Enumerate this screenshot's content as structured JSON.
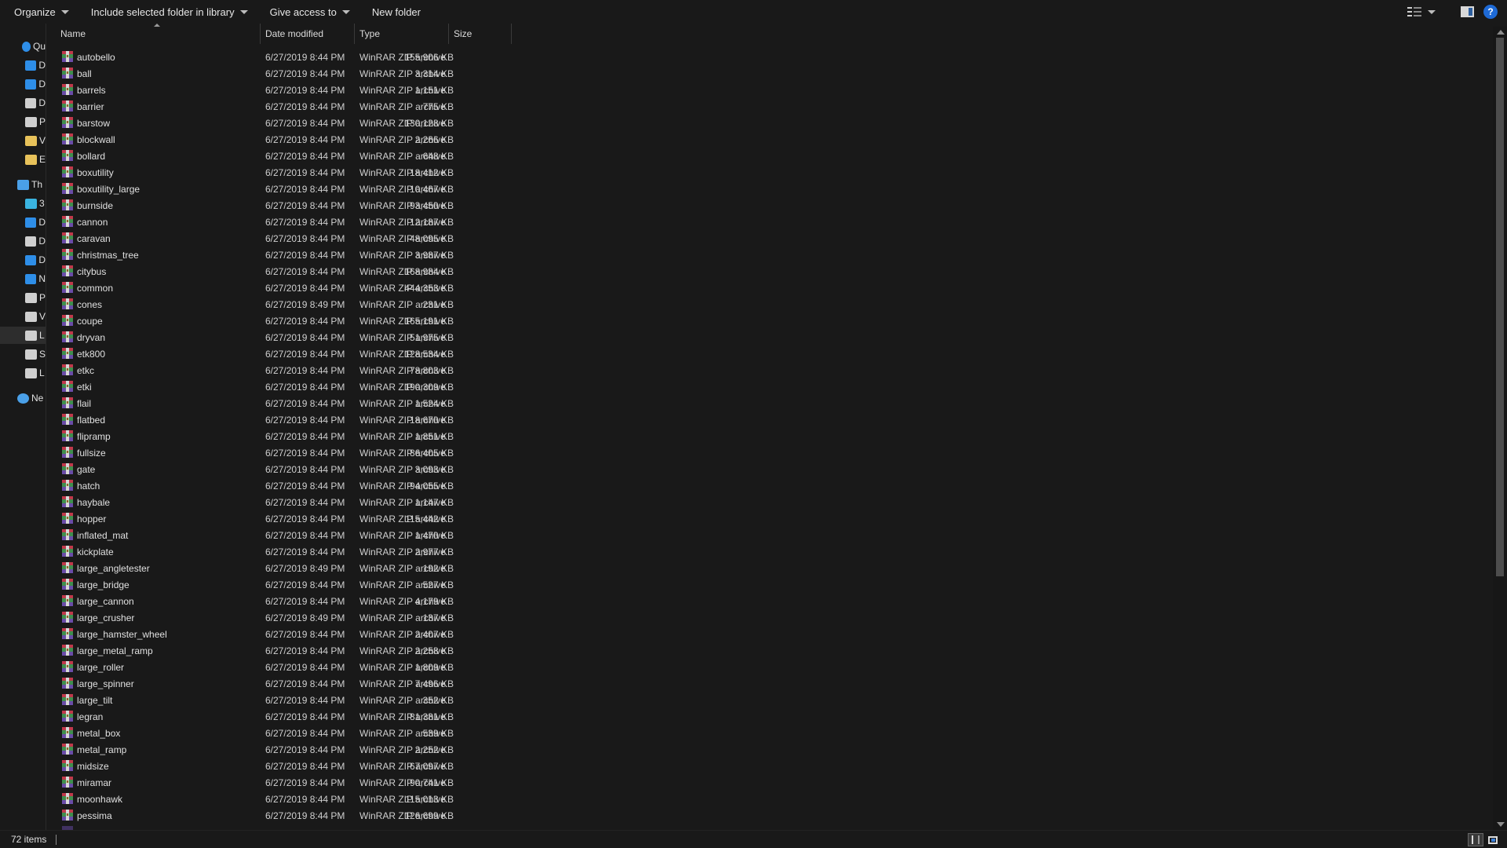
{
  "toolbar": {
    "organize": "Organize",
    "include_library": "Include selected folder in library",
    "give_access": "Give access to",
    "new_folder": "New folder"
  },
  "nav": {
    "items": [
      {
        "label": "Qu",
        "icon": "star-icon",
        "color": "#2e8ee8"
      },
      {
        "label": "D",
        "icon": "desktop-icon",
        "color": "#2e8ee8"
      },
      {
        "label": "D",
        "icon": "download-arrow-icon",
        "color": "#2e8ee8"
      },
      {
        "label": "D",
        "icon": "document-icon",
        "color": "#cfcfcf"
      },
      {
        "label": "P",
        "icon": "pictures-icon",
        "color": "#cfcfcf"
      },
      {
        "label": "V",
        "icon": "folder-icon",
        "color": "#e8c25a"
      },
      {
        "label": "E",
        "icon": "folder-icon",
        "color": "#e8c25a"
      },
      {
        "label": "Th",
        "icon": "computer-icon",
        "color": "#4aa0e8"
      },
      {
        "label": "3",
        "icon": "3d-objects-icon",
        "color": "#3ab4e0"
      },
      {
        "label": "D",
        "icon": "desktop-icon",
        "color": "#2e8ee8"
      },
      {
        "label": "D",
        "icon": "document-icon",
        "color": "#cfcfcf"
      },
      {
        "label": "D",
        "icon": "download-arrow-icon",
        "color": "#2e8ee8"
      },
      {
        "label": "N",
        "icon": "music-icon",
        "color": "#2e8ee8"
      },
      {
        "label": "P",
        "icon": "pictures-icon",
        "color": "#cfcfcf"
      },
      {
        "label": "V",
        "icon": "videos-icon",
        "color": "#cfcfcf"
      },
      {
        "label": "L",
        "icon": "drive-icon",
        "color": "#cfcfcf"
      },
      {
        "label": "S",
        "icon": "drive-icon",
        "color": "#cfcfcf"
      },
      {
        "label": "L",
        "icon": "drive-icon",
        "color": "#cfcfcf"
      },
      {
        "label": "Ne",
        "icon": "network-icon",
        "color": "#4aa0e8"
      }
    ]
  },
  "columns": {
    "name": "Name",
    "date": "Date modified",
    "type": "Type",
    "size": "Size"
  },
  "files": [
    {
      "name": "autobello",
      "date": "6/27/2019 8:44 PM",
      "type": "WinRAR ZIP archive",
      "size": "155,906 KB"
    },
    {
      "name": "ball",
      "date": "6/27/2019 8:44 PM",
      "type": "WinRAR ZIP archive",
      "size": "3,314 KB"
    },
    {
      "name": "barrels",
      "date": "6/27/2019 8:44 PM",
      "type": "WinRAR ZIP archive",
      "size": "1,151 KB"
    },
    {
      "name": "barrier",
      "date": "6/27/2019 8:44 PM",
      "type": "WinRAR ZIP archive",
      "size": "775 KB"
    },
    {
      "name": "barstow",
      "date": "6/27/2019 8:44 PM",
      "type": "WinRAR ZIP archive",
      "size": "130,128 KB"
    },
    {
      "name": "blockwall",
      "date": "6/27/2019 8:44 PM",
      "type": "WinRAR ZIP archive",
      "size": "2,266 KB"
    },
    {
      "name": "bollard",
      "date": "6/27/2019 8:44 PM",
      "type": "WinRAR ZIP archive",
      "size": "648 KB"
    },
    {
      "name": "boxutility",
      "date": "6/27/2019 8:44 PM",
      "type": "WinRAR ZIP archive",
      "size": "18,412 KB"
    },
    {
      "name": "boxutility_large",
      "date": "6/27/2019 8:44 PM",
      "type": "WinRAR ZIP archive",
      "size": "10,467 KB"
    },
    {
      "name": "burnside",
      "date": "6/27/2019 8:44 PM",
      "type": "WinRAR ZIP archive",
      "size": "93,450 KB"
    },
    {
      "name": "cannon",
      "date": "6/27/2019 8:44 PM",
      "type": "WinRAR ZIP archive",
      "size": "12,187 KB"
    },
    {
      "name": "caravan",
      "date": "6/27/2019 8:44 PM",
      "type": "WinRAR ZIP archive",
      "size": "48,095 KB"
    },
    {
      "name": "christmas_tree",
      "date": "6/27/2019 8:44 PM",
      "type": "WinRAR ZIP archive",
      "size": "3,987 KB"
    },
    {
      "name": "citybus",
      "date": "6/27/2019 8:44 PM",
      "type": "WinRAR ZIP archive",
      "size": "168,984 KB"
    },
    {
      "name": "common",
      "date": "6/27/2019 8:44 PM",
      "type": "WinRAR ZIP archive",
      "size": "444,353 KB"
    },
    {
      "name": "cones",
      "date": "6/27/2019 8:49 PM",
      "type": "WinRAR ZIP archive",
      "size": "231 KB"
    },
    {
      "name": "coupe",
      "date": "6/27/2019 8:44 PM",
      "type": "WinRAR ZIP archive",
      "size": "165,191 KB"
    },
    {
      "name": "dryvan",
      "date": "6/27/2019 8:44 PM",
      "type": "WinRAR ZIP archive",
      "size": "51,975 KB"
    },
    {
      "name": "etk800",
      "date": "6/27/2019 8:44 PM",
      "type": "WinRAR ZIP archive",
      "size": "128,534 KB"
    },
    {
      "name": "etkc",
      "date": "6/27/2019 8:44 PM",
      "type": "WinRAR ZIP archive",
      "size": "78,803 KB"
    },
    {
      "name": "etki",
      "date": "6/27/2019 8:44 PM",
      "type": "WinRAR ZIP archive",
      "size": "190,309 KB"
    },
    {
      "name": "flail",
      "date": "6/27/2019 8:44 PM",
      "type": "WinRAR ZIP archive",
      "size": "1,524 KB"
    },
    {
      "name": "flatbed",
      "date": "6/27/2019 8:44 PM",
      "type": "WinRAR ZIP archive",
      "size": "18,670 KB"
    },
    {
      "name": "flipramp",
      "date": "6/27/2019 8:44 PM",
      "type": "WinRAR ZIP archive",
      "size": "1,851 KB"
    },
    {
      "name": "fullsize",
      "date": "6/27/2019 8:44 PM",
      "type": "WinRAR ZIP archive",
      "size": "86,405 KB"
    },
    {
      "name": "gate",
      "date": "6/27/2019 8:44 PM",
      "type": "WinRAR ZIP archive",
      "size": "3,093 KB"
    },
    {
      "name": "hatch",
      "date": "6/27/2019 8:44 PM",
      "type": "WinRAR ZIP archive",
      "size": "94,055 KB"
    },
    {
      "name": "haybale",
      "date": "6/27/2019 8:44 PM",
      "type": "WinRAR ZIP archive",
      "size": "1,147 KB"
    },
    {
      "name": "hopper",
      "date": "6/27/2019 8:44 PM",
      "type": "WinRAR ZIP archive",
      "size": "115,442 KB"
    },
    {
      "name": "inflated_mat",
      "date": "6/27/2019 8:44 PM",
      "type": "WinRAR ZIP archive",
      "size": "1,470 KB"
    },
    {
      "name": "kickplate",
      "date": "6/27/2019 8:44 PM",
      "type": "WinRAR ZIP archive",
      "size": "2,977 KB"
    },
    {
      "name": "large_angletester",
      "date": "6/27/2019 8:49 PM",
      "type": "WinRAR ZIP archive",
      "size": "192 KB"
    },
    {
      "name": "large_bridge",
      "date": "6/27/2019 8:44 PM",
      "type": "WinRAR ZIP archive",
      "size": "527 KB"
    },
    {
      "name": "large_cannon",
      "date": "6/27/2019 8:44 PM",
      "type": "WinRAR ZIP archive",
      "size": "4,179 KB"
    },
    {
      "name": "large_crusher",
      "date": "6/27/2019 8:49 PM",
      "type": "WinRAR ZIP archive",
      "size": "137 KB"
    },
    {
      "name": "large_hamster_wheel",
      "date": "6/27/2019 8:44 PM",
      "type": "WinRAR ZIP archive",
      "size": "2,407 KB"
    },
    {
      "name": "large_metal_ramp",
      "date": "6/27/2019 8:44 PM",
      "type": "WinRAR ZIP archive",
      "size": "2,258 KB"
    },
    {
      "name": "large_roller",
      "date": "6/27/2019 8:44 PM",
      "type": "WinRAR ZIP archive",
      "size": "1,809 KB"
    },
    {
      "name": "large_spinner",
      "date": "6/27/2019 8:44 PM",
      "type": "WinRAR ZIP archive",
      "size": "7,496 KB"
    },
    {
      "name": "large_tilt",
      "date": "6/27/2019 8:44 PM",
      "type": "WinRAR ZIP archive",
      "size": "352 KB"
    },
    {
      "name": "legran",
      "date": "6/27/2019 8:44 PM",
      "type": "WinRAR ZIP archive",
      "size": "81,381 KB"
    },
    {
      "name": "metal_box",
      "date": "6/27/2019 8:44 PM",
      "type": "WinRAR ZIP archive",
      "size": "539 KB"
    },
    {
      "name": "metal_ramp",
      "date": "6/27/2019 8:44 PM",
      "type": "WinRAR ZIP archive",
      "size": "2,252 KB"
    },
    {
      "name": "midsize",
      "date": "6/27/2019 8:44 PM",
      "type": "WinRAR ZIP archive",
      "size": "67,097 KB"
    },
    {
      "name": "miramar",
      "date": "6/27/2019 8:44 PM",
      "type": "WinRAR ZIP archive",
      "size": "90,741 KB"
    },
    {
      "name": "moonhawk",
      "date": "6/27/2019 8:44 PM",
      "type": "WinRAR ZIP archive",
      "size": "115,013 KB"
    },
    {
      "name": "pessima",
      "date": "6/27/2019 8:44 PM",
      "type": "WinRAR ZIP archive",
      "size": "126,699 KB"
    }
  ],
  "status": {
    "item_count": "72 items"
  },
  "icons": {
    "file": "winrar-archive-icon",
    "view_options": "view-options-icon",
    "preview_pane": "preview-pane-icon",
    "help": "help-icon",
    "help_glyph": "?"
  }
}
